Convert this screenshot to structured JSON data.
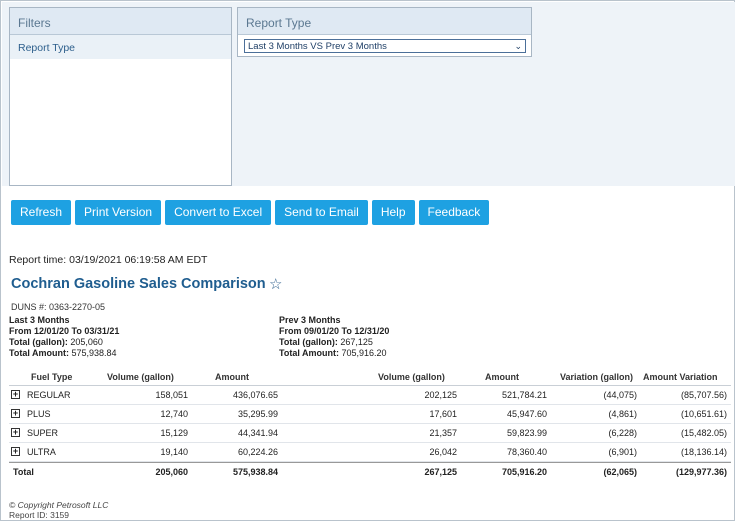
{
  "filters": {
    "title": "Filters",
    "items": [
      "Report Type"
    ]
  },
  "report_type": {
    "title": "Report Type",
    "selected": "Last 3 Months VS Prev 3 Months"
  },
  "toolbar": {
    "buttons": [
      "Refresh",
      "Print Version",
      "Convert to Excel",
      "Send to Email",
      "Help",
      "Feedback"
    ]
  },
  "report": {
    "time": "Report time: 03/19/2021 06:19:58 AM EDT",
    "title": "Cochran Gasoline Sales Comparison",
    "duns": "DUNS #: 0363-2270-05"
  },
  "periods": {
    "current": {
      "label": "Last 3 Months",
      "range": "From 12/01/20 To 03/31/21",
      "gallons_label": "Total (gallon):",
      "gallons": "205,060",
      "amount_label": "Total Amount:",
      "amount": "575,938.84"
    },
    "previous": {
      "label": "Prev 3 Months",
      "range": "From 09/01/20 To 12/31/20",
      "gallons_label": "Total (gallon):",
      "gallons": "267,125",
      "amount_label": "Total Amount:",
      "amount": "705,916.20"
    }
  },
  "table": {
    "columns": [
      "Fuel Type",
      "Volume (gallon)",
      "Amount",
      "Volume (gallon)",
      "Amount",
      "Variation (gallon)",
      "Amount Variation"
    ],
    "rows": [
      {
        "fuel": "REGULAR",
        "vol1": "158,051",
        "amt1": "436,076.65",
        "vol2": "202,125",
        "amt2": "521,784.21",
        "var_gal": "(44,075)",
        "var_amt": "(85,707.56)"
      },
      {
        "fuel": "PLUS",
        "vol1": "12,740",
        "amt1": "35,295.99",
        "vol2": "17,601",
        "amt2": "45,947.60",
        "var_gal": "(4,861)",
        "var_amt": "(10,651.61)"
      },
      {
        "fuel": "SUPER",
        "vol1": "15,129",
        "amt1": "44,341.94",
        "vol2": "21,357",
        "amt2": "59,823.99",
        "var_gal": "(6,228)",
        "var_amt": "(15,482.05)"
      },
      {
        "fuel": "ULTRA",
        "vol1": "19,140",
        "amt1": "60,224.26",
        "vol2": "26,042",
        "amt2": "78,360.40",
        "var_gal": "(6,901)",
        "var_amt": "(18,136.14)"
      }
    ],
    "total": {
      "label": "Total",
      "vol1": "205,060",
      "amt1": "575,938.84",
      "vol2": "267,125",
      "amt2": "705,916.20",
      "var_gal": "(62,065)",
      "var_amt": "(129,977.36)"
    }
  },
  "footer": {
    "copyright": "© Copyright Petrosoft LLC",
    "report_id": "Report ID: 3159"
  }
}
